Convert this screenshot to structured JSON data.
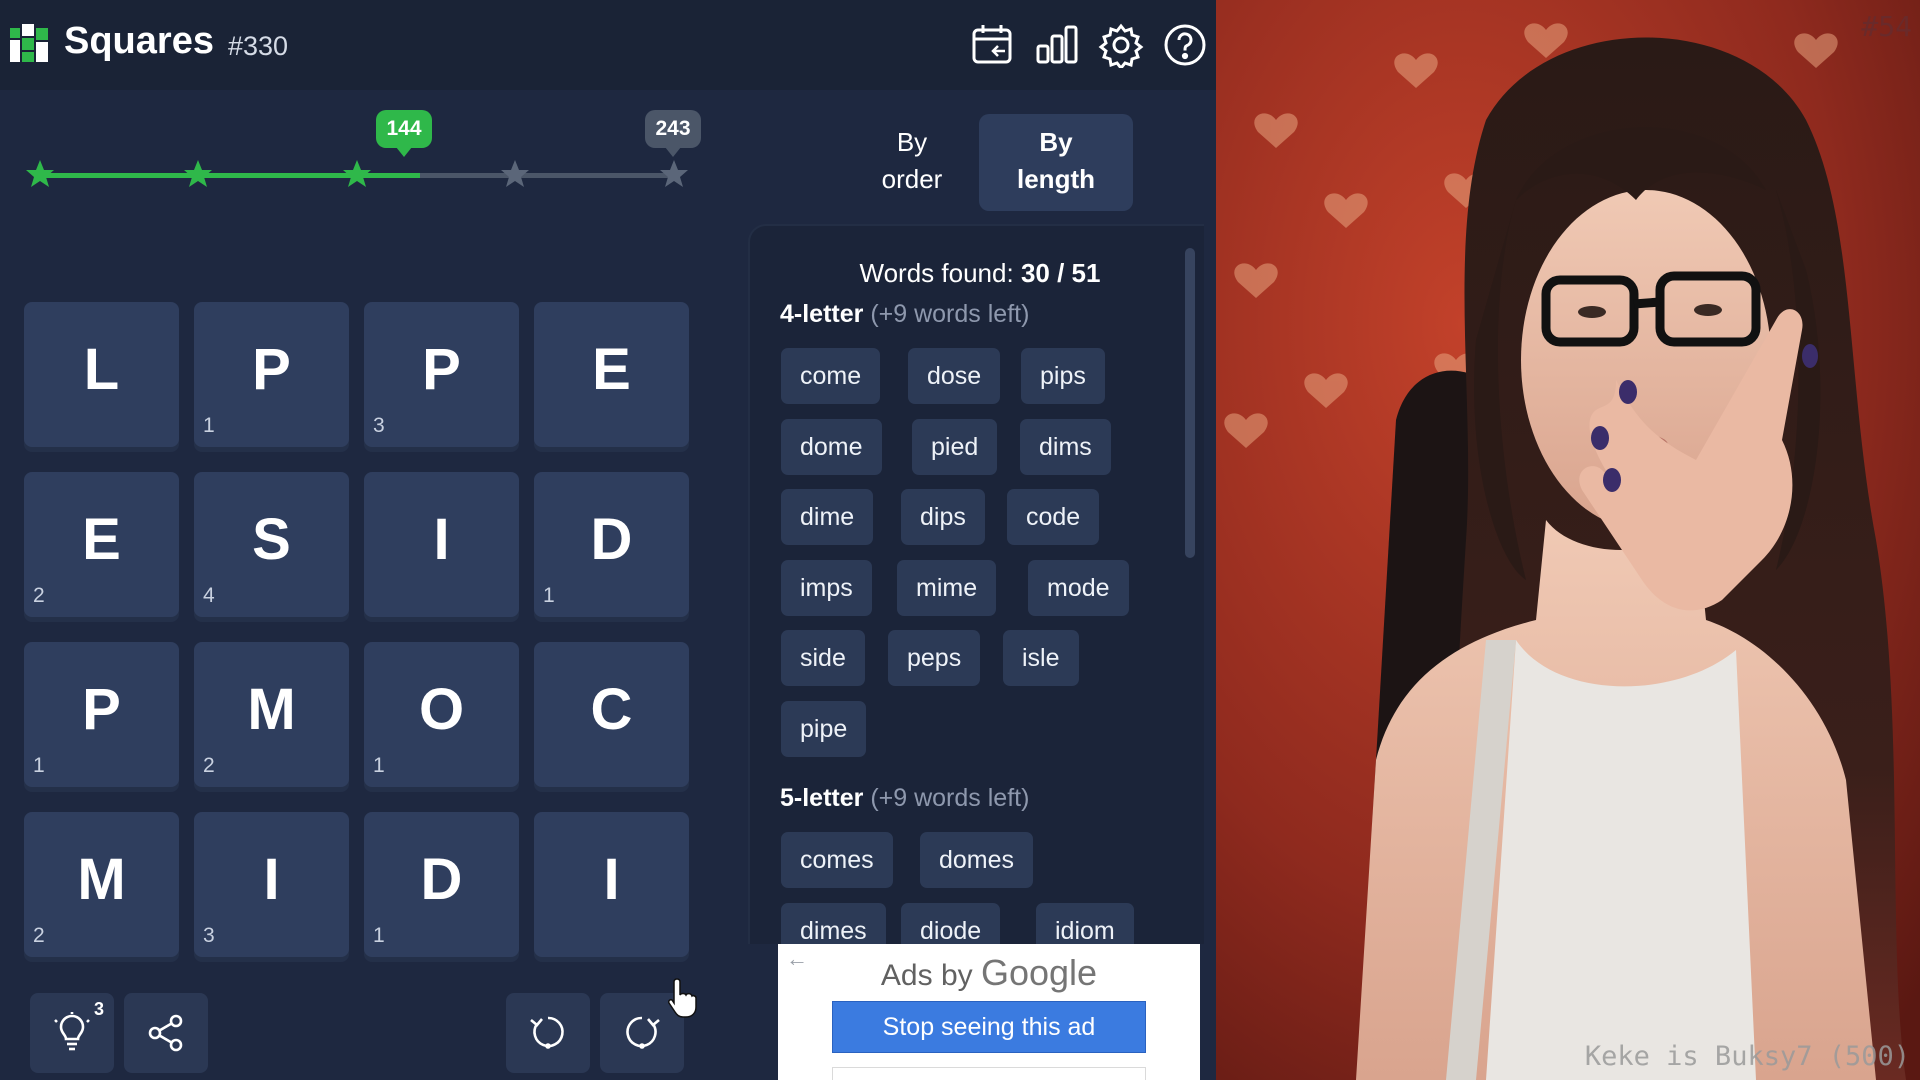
{
  "header": {
    "title": "Squares",
    "puzzle_number": "#330",
    "icons": [
      "calendar-icon",
      "stats-icon",
      "gear-icon",
      "help-icon"
    ]
  },
  "progress": {
    "current_score": "144",
    "max_score": "243",
    "current_fraction": 0.593,
    "stars_reached": 3,
    "stars_total": 5
  },
  "sort": {
    "order_label": [
      "By",
      "order"
    ],
    "length_label": [
      "By",
      "length"
    ],
    "selected": "length"
  },
  "grid": {
    "rows": [
      [
        {
          "letter": "L",
          "count": ""
        },
        {
          "letter": "P",
          "count": "1"
        },
        {
          "letter": "P",
          "count": "3"
        },
        {
          "letter": "E",
          "count": ""
        }
      ],
      [
        {
          "letter": "E",
          "count": "2"
        },
        {
          "letter": "S",
          "count": "4"
        },
        {
          "letter": "I",
          "count": ""
        },
        {
          "letter": "D",
          "count": "1"
        }
      ],
      [
        {
          "letter": "P",
          "count": "1"
        },
        {
          "letter": "M",
          "count": "2"
        },
        {
          "letter": "O",
          "count": "1"
        },
        {
          "letter": "C",
          "count": ""
        }
      ],
      [
        {
          "letter": "M",
          "count": "2"
        },
        {
          "letter": "I",
          "count": "3"
        },
        {
          "letter": "D",
          "count": "1"
        },
        {
          "letter": "I",
          "count": ""
        }
      ]
    ]
  },
  "tools": {
    "hint_badge": "3",
    "icons": [
      "lightbulb-icon",
      "share-icon",
      "rotate-left-icon",
      "rotate-right-icon"
    ]
  },
  "words": {
    "found_label": "Words found:",
    "found_count": "30 / 51",
    "groups": [
      {
        "title": "4-letter",
        "remaining": "(+9 words left)",
        "words": [
          "come",
          "dose",
          "pips",
          "dome",
          "pied",
          "dims",
          "dime",
          "dips",
          "code",
          "imps",
          "mime",
          "mode",
          "side",
          "peps",
          "isle",
          "pipe"
        ]
      },
      {
        "title": "5-letter",
        "remaining": "(+9 words left)",
        "words": [
          "comes",
          "domes",
          "dimes",
          "diode",
          "idiom"
        ]
      }
    ]
  },
  "ad": {
    "label_prefix": "Ads by",
    "label_brand": "Google",
    "stop_button": "Stop seeing this ad"
  },
  "webcam": {
    "tag": "#54",
    "caption": "Keke is Buksy7 (500)"
  },
  "colors": {
    "green": "#2fb84a",
    "tile": "#2f3e5e",
    "panel": "#1b2439",
    "chip": "#2c3a56",
    "ad_button": "#3b7be0"
  }
}
